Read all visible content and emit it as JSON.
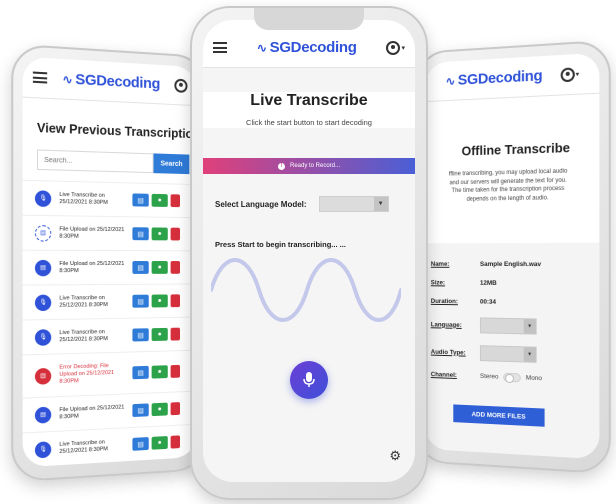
{
  "brand": {
    "name": "SGDecoding",
    "wave_glyph": "∿",
    "accent": "#2f52d8"
  },
  "left_screen": {
    "title": "View Previous Transcription Jo",
    "search": {
      "placeholder": "Search...",
      "button_label": "Search"
    },
    "jobs": [
      {
        "icon": "mic-icon",
        "text": "Live Transcribe on 25/12/2021 8:30PM",
        "status": "normal"
      },
      {
        "icon": "file-icon",
        "text": "File Upload on 25/12/2021 8:30PM",
        "status": "pending"
      },
      {
        "icon": "file-icon",
        "text": "File Upload on 25/12/2021 8:30PM",
        "status": "normal"
      },
      {
        "icon": "mic-icon",
        "text": "Live Transcribe on 25/12/2021 8:30PM",
        "status": "normal"
      },
      {
        "icon": "mic-icon",
        "text": "Live Transcribe on 25/12/2021 8:30PM",
        "status": "normal"
      },
      {
        "icon": "file-icon",
        "text": "Error Decoding: File Upload on 25/12/2021 8:30PM",
        "status": "error"
      },
      {
        "icon": "file-icon",
        "text": "File Upload on 25/12/2021 8:30PM",
        "status": "normal"
      },
      {
        "icon": "mic-icon",
        "text": "Live Transcribe on 25/12/2021 8:30PM",
        "status": "normal"
      }
    ]
  },
  "center_screen": {
    "title": "Live Transcribe",
    "subtitle": "Click the start button to start decoding",
    "banner": "Ready to Record...",
    "language_label": "Select Language Model:",
    "prompt": "Press Start to begin transcribing... ...",
    "colors": {
      "banner_start": "#e0407a",
      "banner_end": "#4a5fd6",
      "mic": "#5548d8",
      "wave": "#c4c9ec"
    }
  },
  "right_screen": {
    "title": "Offline Transcribe",
    "description": [
      "ffline transcribing, you may upload local audio",
      "and our servers will generate the text for you.",
      "The time taken for the transcription process",
      "depends on the length of audio."
    ],
    "fields": {
      "name_label": "Name:",
      "name_value": "Sample English.wav",
      "size_label": "Size:",
      "size_value": "12MB",
      "duration_label": "Duration:",
      "duration_value": "00:34",
      "language_label": "Language:",
      "audio_type_label": "Audio Type:",
      "channel_label": "Channel:",
      "channel_left": "Stereo",
      "channel_right": "Mono"
    },
    "add_button": "ADD MORE FILES"
  }
}
